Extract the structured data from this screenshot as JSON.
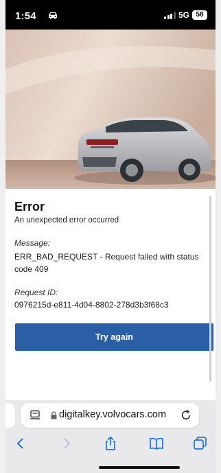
{
  "status_bar": {
    "time": "1:54",
    "network": "5G",
    "battery": "58"
  },
  "error": {
    "title": "Error",
    "subtitle": "An unexpected error occurred",
    "message_label": "Message:",
    "message_text": "ERR_BAD_REQUEST - Request failed with status code 409",
    "request_label": "Request ID:",
    "request_id": "0976215d-e811-4d04-8802-278d3b3f68c3",
    "button_label": "Try again"
  },
  "browser": {
    "url": "digitalkey.volvocars.com"
  },
  "colors": {
    "button": "#2a5fa6",
    "toolbar_icon": "#1a73e8"
  },
  "icons": [
    "car-icon",
    "signal-icon",
    "battery-icon",
    "reader-icon",
    "lock-icon",
    "reload-icon",
    "back-icon",
    "forward-icon",
    "share-icon",
    "bookmarks-icon",
    "tabs-icon"
  ]
}
